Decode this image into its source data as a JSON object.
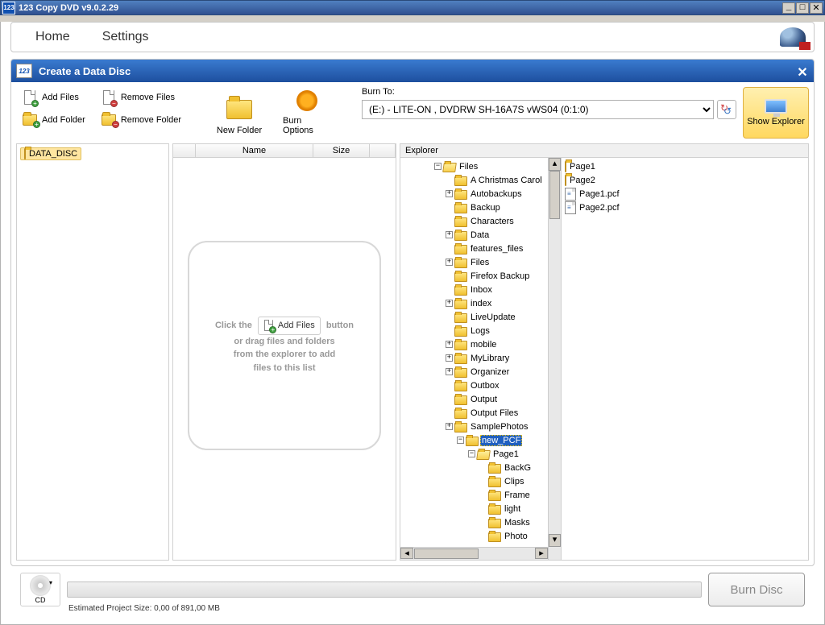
{
  "titlebar": {
    "icon_text": "123",
    "title": "123 Copy DVD v9.0.2.29"
  },
  "menubar": {
    "home": "Home",
    "settings": "Settings"
  },
  "section": {
    "title": "Create a Data Disc"
  },
  "toolbar": {
    "add_files": "Add Files",
    "remove_files": "Remove Files",
    "add_folder": "Add Folder",
    "remove_folder": "Remove Folder",
    "new_folder": "New Folder",
    "burn_options": "Burn Options",
    "burn_to_label": "Burn To:",
    "burn_to_value": "(E:) - LITE-ON , DVDRW SH-16A7S   vWS04 (0:1:0)",
    "show_explorer": "Show Explorer"
  },
  "left_root": "DATA_DISC",
  "list_headers": {
    "name": "Name",
    "size": "Size"
  },
  "drop_hint": {
    "line1a": "Click the",
    "chip": "Add Files",
    "line1b": "button",
    "line2": "or drag files and folders",
    "line3": "from the explorer to add",
    "line4": "files to this list"
  },
  "explorer": {
    "label": "Explorer",
    "tree": [
      {
        "indent": 3,
        "expand": "-",
        "open": true,
        "label": "Files",
        "sel": false
      },
      {
        "indent": 4,
        "expand": "",
        "open": false,
        "label": "A Christmas Carol",
        "sel": false
      },
      {
        "indent": 4,
        "expand": "+",
        "open": false,
        "label": "Autobackups",
        "sel": false
      },
      {
        "indent": 4,
        "expand": "",
        "open": false,
        "label": "Backup",
        "sel": false
      },
      {
        "indent": 4,
        "expand": "",
        "open": false,
        "label": "Characters",
        "sel": false
      },
      {
        "indent": 4,
        "expand": "+",
        "open": false,
        "label": "Data",
        "sel": false
      },
      {
        "indent": 4,
        "expand": "",
        "open": false,
        "label": "features_files",
        "sel": false
      },
      {
        "indent": 4,
        "expand": "+",
        "open": false,
        "label": "Files",
        "sel": false
      },
      {
        "indent": 4,
        "expand": "",
        "open": false,
        "label": "Firefox Backup",
        "sel": false
      },
      {
        "indent": 4,
        "expand": "",
        "open": false,
        "label": "Inbox",
        "sel": false
      },
      {
        "indent": 4,
        "expand": "+",
        "open": false,
        "label": "index",
        "sel": false
      },
      {
        "indent": 4,
        "expand": "",
        "open": false,
        "label": "LiveUpdate",
        "sel": false
      },
      {
        "indent": 4,
        "expand": "",
        "open": false,
        "label": "Logs",
        "sel": false
      },
      {
        "indent": 4,
        "expand": "+",
        "open": false,
        "label": "mobile",
        "sel": false
      },
      {
        "indent": 4,
        "expand": "+",
        "open": false,
        "label": "MyLibrary",
        "sel": false
      },
      {
        "indent": 4,
        "expand": "+",
        "open": false,
        "label": "Organizer",
        "sel": false
      },
      {
        "indent": 4,
        "expand": "",
        "open": false,
        "label": "Outbox",
        "sel": false
      },
      {
        "indent": 4,
        "expand": "",
        "open": false,
        "label": "Output",
        "sel": false
      },
      {
        "indent": 4,
        "expand": "",
        "open": false,
        "label": "Output Files",
        "sel": false
      },
      {
        "indent": 4,
        "expand": "+",
        "open": false,
        "label": "SamplePhotos",
        "sel": false
      },
      {
        "indent": 5,
        "expand": "-",
        "open": false,
        "label": "new_PCF",
        "sel": true
      },
      {
        "indent": 6,
        "expand": "-",
        "open": true,
        "label": "Page1",
        "sel": false
      },
      {
        "indent": 7,
        "expand": "",
        "open": false,
        "label": "BackG",
        "sel": false
      },
      {
        "indent": 7,
        "expand": "",
        "open": false,
        "label": "Clips",
        "sel": false
      },
      {
        "indent": 7,
        "expand": "",
        "open": false,
        "label": "Frame",
        "sel": false
      },
      {
        "indent": 7,
        "expand": "",
        "open": false,
        "label": "light",
        "sel": false
      },
      {
        "indent": 7,
        "expand": "",
        "open": false,
        "label": "Masks",
        "sel": false
      },
      {
        "indent": 7,
        "expand": "",
        "open": false,
        "label": "Photo",
        "sel": false
      }
    ],
    "files": [
      {
        "type": "folder",
        "name": "Page1"
      },
      {
        "type": "folder",
        "name": "Page2"
      },
      {
        "type": "pcf",
        "name": "Page1.pcf"
      },
      {
        "type": "pcf",
        "name": "Page2.pcf"
      }
    ]
  },
  "bottom": {
    "cd_label": "CD",
    "status": "Estimated Project Size: 0,00 of 891,00 MB",
    "burn": "Burn Disc"
  }
}
